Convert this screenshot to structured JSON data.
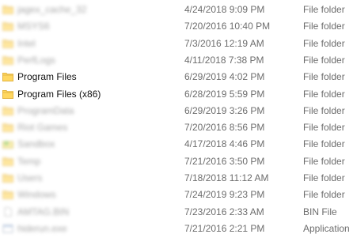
{
  "colors": {
    "folder_fill": "#ffd760",
    "folder_edge": "#e3b543",
    "text_primary": "#111111",
    "text_secondary": "#6d6d6d"
  },
  "files": [
    {
      "name": "jagex_cache_32",
      "date_modified": "4/24/2018 9:09 PM",
      "type": "File folder",
      "icon": "folder-icon",
      "blurred": true
    },
    {
      "name": "MSYS6",
      "date_modified": "7/20/2016 10:40 PM",
      "type": "File folder",
      "icon": "folder-icon",
      "blurred": true
    },
    {
      "name": "Intel",
      "date_modified": "7/3/2016 12:19 AM",
      "type": "File folder",
      "icon": "folder-icon",
      "blurred": true
    },
    {
      "name": "PerfLogs",
      "date_modified": "4/11/2018 7:38 PM",
      "type": "File folder",
      "icon": "folder-icon",
      "blurred": true
    },
    {
      "name": "Program Files",
      "date_modified": "6/29/2019 4:02 PM",
      "type": "File folder",
      "icon": "folder-icon",
      "blurred": false
    },
    {
      "name": "Program Files (x86)",
      "date_modified": "6/28/2019 5:59 PM",
      "type": "File folder",
      "icon": "folder-icon",
      "blurred": false
    },
    {
      "name": "ProgramData",
      "date_modified": "6/29/2019 3:26 PM",
      "type": "File folder",
      "icon": "folder-icon",
      "blurred": true
    },
    {
      "name": "Riot Games",
      "date_modified": "7/20/2016 8:56 PM",
      "type": "File folder",
      "icon": "folder-icon",
      "blurred": true
    },
    {
      "name": "Sandbox",
      "date_modified": "4/17/2018 4:46 PM",
      "type": "File folder",
      "icon": "sandbox-folder-icon",
      "blurred": true
    },
    {
      "name": "Temp",
      "date_modified": "7/21/2016 3:50 PM",
      "type": "File folder",
      "icon": "folder-icon",
      "blurred": true
    },
    {
      "name": "Users",
      "date_modified": "7/18/2018 11:12 AM",
      "type": "File folder",
      "icon": "folder-icon",
      "blurred": true
    },
    {
      "name": "Windows",
      "date_modified": "7/24/2019 9:23 PM",
      "type": "File folder",
      "icon": "folder-icon",
      "blurred": true
    },
    {
      "name": "AMTAG.BIN",
      "date_modified": "7/23/2016 2:33 AM",
      "type": "BIN File",
      "icon": "file-icon",
      "blurred": true
    },
    {
      "name": "hiderun.exe",
      "date_modified": "7/21/2016 2:21 PM",
      "type": "Application",
      "icon": "application-icon",
      "blurred": true
    }
  ]
}
